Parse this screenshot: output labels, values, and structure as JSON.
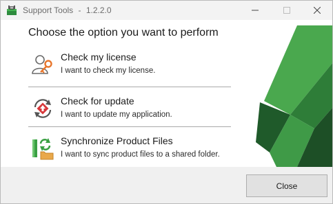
{
  "window": {
    "title": "Support Tools",
    "separator": "-",
    "version": "1.2.2.0"
  },
  "main": {
    "heading": "Choose the option you want to perform",
    "options": [
      {
        "icon": "user-key-icon",
        "title": "Check my license",
        "description": "I want to check my license."
      },
      {
        "icon": "update-icon",
        "title": "Check for update",
        "description": "I want to update my application."
      },
      {
        "icon": "sync-files-icon",
        "title": "Synchronize Product Files",
        "description": "I want to sync product files to a shared folder."
      }
    ]
  },
  "footer": {
    "close_label": "Close"
  },
  "colors": {
    "accent_green": "#3aa043",
    "accent_orange": "#e8762c",
    "accent_red": "#d8373a"
  }
}
